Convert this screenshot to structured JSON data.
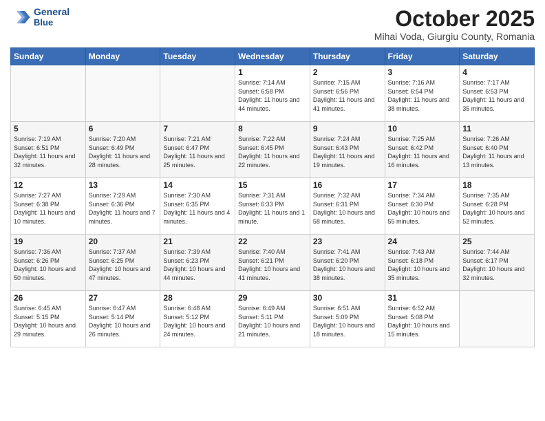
{
  "header": {
    "logo_line1": "General",
    "logo_line2": "Blue",
    "month_title": "October 2025",
    "subtitle": "Mihai Voda, Giurgiu County, Romania"
  },
  "days_of_week": [
    "Sunday",
    "Monday",
    "Tuesday",
    "Wednesday",
    "Thursday",
    "Friday",
    "Saturday"
  ],
  "weeks": [
    [
      {
        "day": "",
        "info": ""
      },
      {
        "day": "",
        "info": ""
      },
      {
        "day": "",
        "info": ""
      },
      {
        "day": "1",
        "info": "Sunrise: 7:14 AM\nSunset: 6:58 PM\nDaylight: 11 hours\nand 44 minutes."
      },
      {
        "day": "2",
        "info": "Sunrise: 7:15 AM\nSunset: 6:56 PM\nDaylight: 11 hours\nand 41 minutes."
      },
      {
        "day": "3",
        "info": "Sunrise: 7:16 AM\nSunset: 6:54 PM\nDaylight: 11 hours\nand 38 minutes."
      },
      {
        "day": "4",
        "info": "Sunrise: 7:17 AM\nSunset: 6:53 PM\nDaylight: 11 hours\nand 35 minutes."
      }
    ],
    [
      {
        "day": "5",
        "info": "Sunrise: 7:19 AM\nSunset: 6:51 PM\nDaylight: 11 hours\nand 32 minutes."
      },
      {
        "day": "6",
        "info": "Sunrise: 7:20 AM\nSunset: 6:49 PM\nDaylight: 11 hours\nand 28 minutes."
      },
      {
        "day": "7",
        "info": "Sunrise: 7:21 AM\nSunset: 6:47 PM\nDaylight: 11 hours\nand 25 minutes."
      },
      {
        "day": "8",
        "info": "Sunrise: 7:22 AM\nSunset: 6:45 PM\nDaylight: 11 hours\nand 22 minutes."
      },
      {
        "day": "9",
        "info": "Sunrise: 7:24 AM\nSunset: 6:43 PM\nDaylight: 11 hours\nand 19 minutes."
      },
      {
        "day": "10",
        "info": "Sunrise: 7:25 AM\nSunset: 6:42 PM\nDaylight: 11 hours\nand 16 minutes."
      },
      {
        "day": "11",
        "info": "Sunrise: 7:26 AM\nSunset: 6:40 PM\nDaylight: 11 hours\nand 13 minutes."
      }
    ],
    [
      {
        "day": "12",
        "info": "Sunrise: 7:27 AM\nSunset: 6:38 PM\nDaylight: 11 hours\nand 10 minutes."
      },
      {
        "day": "13",
        "info": "Sunrise: 7:29 AM\nSunset: 6:36 PM\nDaylight: 11 hours\nand 7 minutes."
      },
      {
        "day": "14",
        "info": "Sunrise: 7:30 AM\nSunset: 6:35 PM\nDaylight: 11 hours\nand 4 minutes."
      },
      {
        "day": "15",
        "info": "Sunrise: 7:31 AM\nSunset: 6:33 PM\nDaylight: 11 hours\nand 1 minute."
      },
      {
        "day": "16",
        "info": "Sunrise: 7:32 AM\nSunset: 6:31 PM\nDaylight: 10 hours\nand 58 minutes."
      },
      {
        "day": "17",
        "info": "Sunrise: 7:34 AM\nSunset: 6:30 PM\nDaylight: 10 hours\nand 55 minutes."
      },
      {
        "day": "18",
        "info": "Sunrise: 7:35 AM\nSunset: 6:28 PM\nDaylight: 10 hours\nand 52 minutes."
      }
    ],
    [
      {
        "day": "19",
        "info": "Sunrise: 7:36 AM\nSunset: 6:26 PM\nDaylight: 10 hours\nand 50 minutes."
      },
      {
        "day": "20",
        "info": "Sunrise: 7:37 AM\nSunset: 6:25 PM\nDaylight: 10 hours\nand 47 minutes."
      },
      {
        "day": "21",
        "info": "Sunrise: 7:39 AM\nSunset: 6:23 PM\nDaylight: 10 hours\nand 44 minutes."
      },
      {
        "day": "22",
        "info": "Sunrise: 7:40 AM\nSunset: 6:21 PM\nDaylight: 10 hours\nand 41 minutes."
      },
      {
        "day": "23",
        "info": "Sunrise: 7:41 AM\nSunset: 6:20 PM\nDaylight: 10 hours\nand 38 minutes."
      },
      {
        "day": "24",
        "info": "Sunrise: 7:43 AM\nSunset: 6:18 PM\nDaylight: 10 hours\nand 35 minutes."
      },
      {
        "day": "25",
        "info": "Sunrise: 7:44 AM\nSunset: 6:17 PM\nDaylight: 10 hours\nand 32 minutes."
      }
    ],
    [
      {
        "day": "26",
        "info": "Sunrise: 6:45 AM\nSunset: 5:15 PM\nDaylight: 10 hours\nand 29 minutes."
      },
      {
        "day": "27",
        "info": "Sunrise: 6:47 AM\nSunset: 5:14 PM\nDaylight: 10 hours\nand 26 minutes."
      },
      {
        "day": "28",
        "info": "Sunrise: 6:48 AM\nSunset: 5:12 PM\nDaylight: 10 hours\nand 24 minutes."
      },
      {
        "day": "29",
        "info": "Sunrise: 6:49 AM\nSunset: 5:11 PM\nDaylight: 10 hours\nand 21 minutes."
      },
      {
        "day": "30",
        "info": "Sunrise: 6:51 AM\nSunset: 5:09 PM\nDaylight: 10 hours\nand 18 minutes."
      },
      {
        "day": "31",
        "info": "Sunrise: 6:52 AM\nSunset: 5:08 PM\nDaylight: 10 hours\nand 15 minutes."
      },
      {
        "day": "",
        "info": ""
      }
    ]
  ]
}
